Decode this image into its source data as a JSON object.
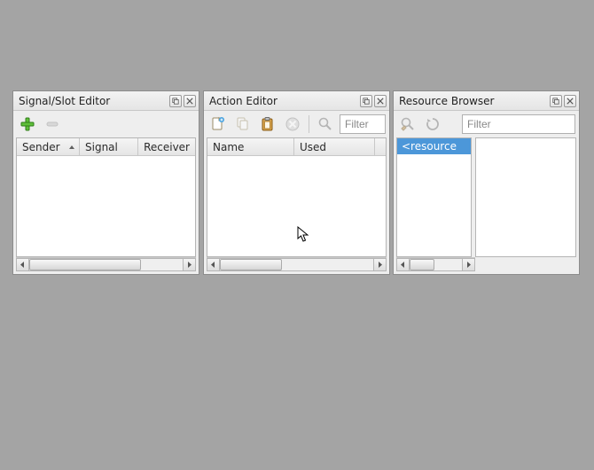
{
  "panels": {
    "signal_slot": {
      "title": "Signal/Slot Editor",
      "columns": {
        "sender": "Sender",
        "signal": "Signal",
        "receiver": "Receiver"
      }
    },
    "action_editor": {
      "title": "Action Editor",
      "filter_placeholder": "Filter",
      "columns": {
        "name": "Name",
        "used": "Used"
      }
    },
    "resource_browser": {
      "title": "Resource Browser",
      "filter_placeholder": "Filter",
      "tree_root": "<resource"
    }
  },
  "icons": {
    "add": "add-icon",
    "remove": "remove-icon",
    "new": "new-action-icon",
    "copy": "copy-icon",
    "paste": "paste-icon",
    "delete": "delete-icon",
    "zoom": "zoom-icon",
    "edit_resources": "edit-resources-icon",
    "reload": "reload-icon",
    "float": "float-icon",
    "close": "close-icon"
  }
}
